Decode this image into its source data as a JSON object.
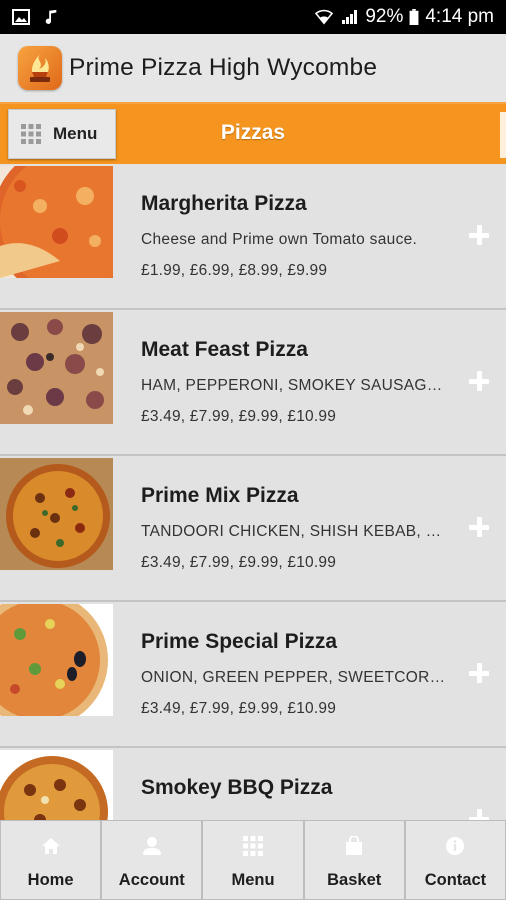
{
  "status_bar": {
    "battery": "92%",
    "time": "4:14 pm",
    "left_icons": [
      "image-icon",
      "music-note-icon"
    ],
    "right_icons": [
      "wifi-icon",
      "signal-icon"
    ]
  },
  "app": {
    "title": "Prime Pizza High Wycombe"
  },
  "category_bar": {
    "menu_label": "Menu",
    "title": "Pizzas",
    "accent": "#f5941e"
  },
  "items": [
    {
      "name": "Margherita Pizza",
      "description": "Cheese and Prime own Tomato sauce.",
      "prices": "£1.99, £6.99, £8.99, £9.99"
    },
    {
      "name": "Meat Feast Pizza",
      "description": "HAM, PEPPERONI, SMOKEY SAUSAGE, …",
      "prices": "£3.49, £7.99, £9.99, £10.99"
    },
    {
      "name": "Prime Mix Pizza",
      "description": "TANDOORI CHICKEN, SHISH KEBAB, S…",
      "prices": "£3.49, £7.99, £9.99, £10.99"
    },
    {
      "name": "Prime Special Pizza",
      "description": "ONION, GREEN PEPPER, SWEETCORN, …",
      "prices": "£3.49, £7.99, £9.99, £10.99"
    },
    {
      "name": "Smokey BBQ Pizza",
      "description": "",
      "prices": ""
    }
  ],
  "bottom_nav": [
    {
      "label": "Home",
      "icon": "home-icon"
    },
    {
      "label": "Account",
      "icon": "user-icon"
    },
    {
      "label": "Menu",
      "icon": "grid-icon"
    },
    {
      "label": "Basket",
      "icon": "basket-icon"
    },
    {
      "label": "Contact",
      "icon": "info-icon"
    }
  ]
}
